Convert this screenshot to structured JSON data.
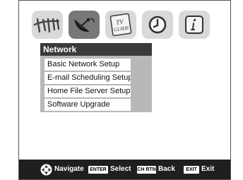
{
  "menu": {
    "title": "Network",
    "items": [
      {
        "label": "Basic Network Setup"
      },
      {
        "label": "E-mail Scheduling Setup"
      },
      {
        "label": "Home File Server Setup"
      },
      {
        "label": "Software Upgrade"
      }
    ]
  },
  "icons": {
    "tv_guide_line1": "TV",
    "tv_guide_line2": "GUIDE"
  },
  "footer": {
    "navigate_label": "Navigate",
    "enter_key": "ENTER",
    "select_label": "Select",
    "chrtn_key": "CH RTN",
    "back_label": "Back",
    "exit_key": "EXIT",
    "exit_label": "Exit"
  },
  "colors": {
    "header_bg": "#3a3a3a",
    "menu_bg": "#b8b8b8",
    "footer_bg": "#1f1f1f",
    "active_tile": "#787878",
    "tile": "#d9d9d9"
  }
}
